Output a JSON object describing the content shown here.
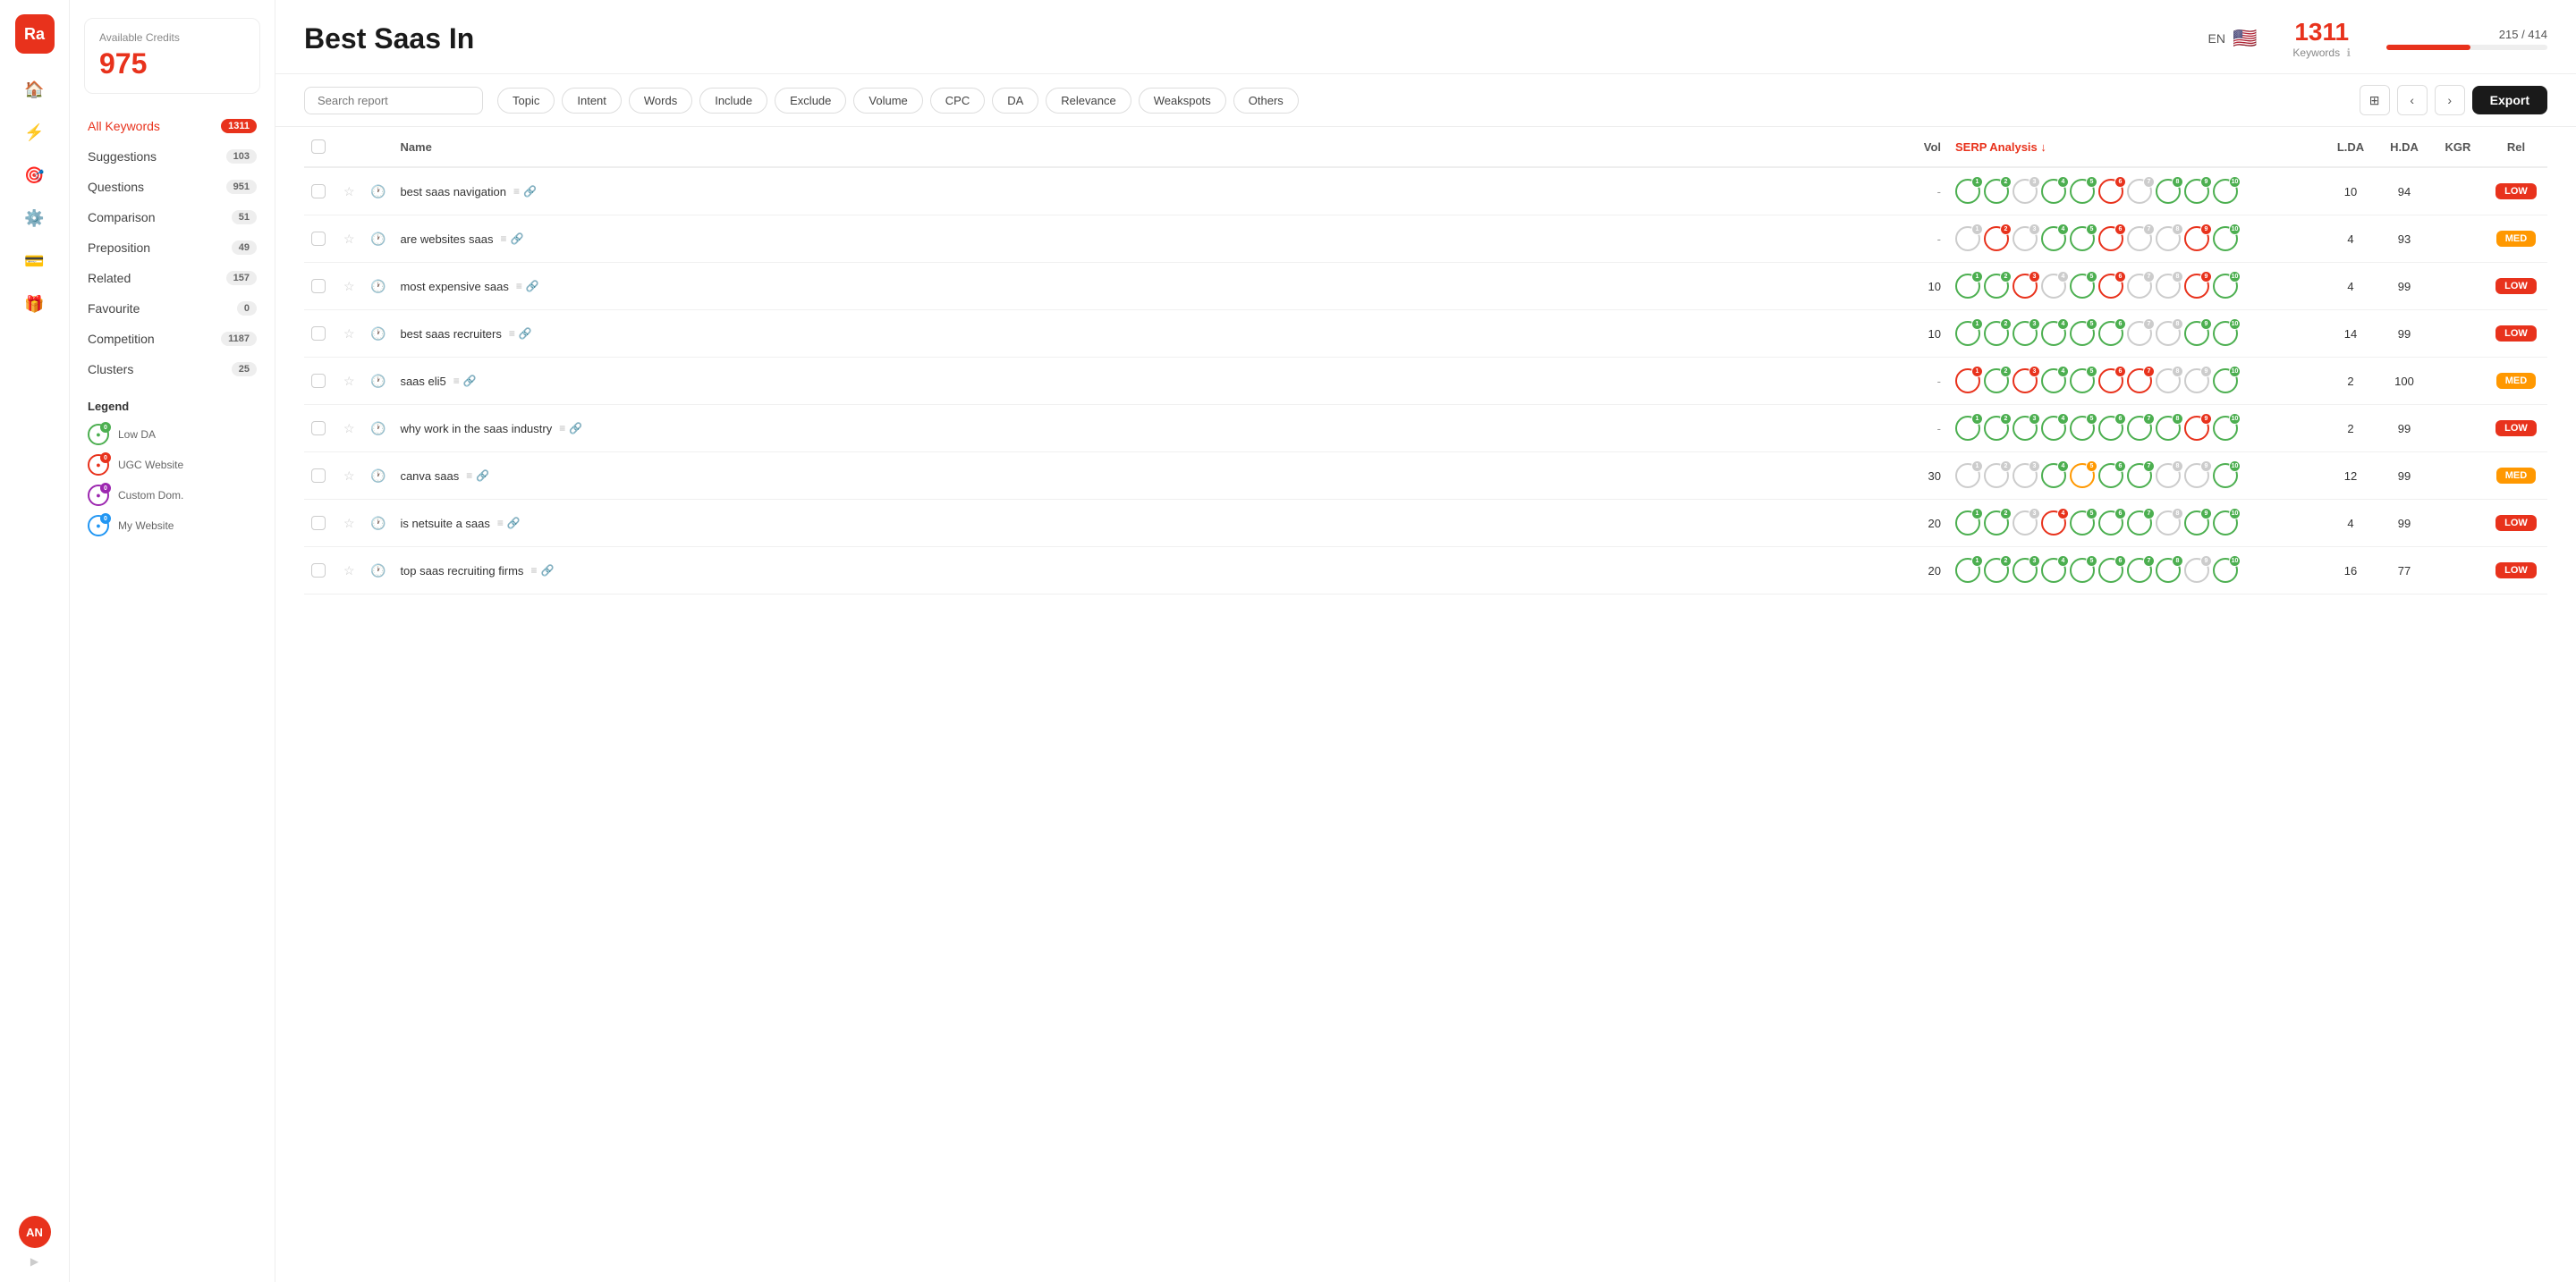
{
  "app": {
    "logo": "Ra",
    "nav_icons": [
      "home",
      "bolt",
      "target",
      "settings",
      "card",
      "gift"
    ],
    "user_initials": "AN"
  },
  "sidebar": {
    "credits_label": "Available Credits",
    "credits_value": "975",
    "items": [
      {
        "label": "All Keywords",
        "count": "1311",
        "active": true
      },
      {
        "label": "Suggestions",
        "count": "103",
        "active": false
      },
      {
        "label": "Questions",
        "count": "951",
        "active": false
      },
      {
        "label": "Comparison",
        "count": "51",
        "active": false
      },
      {
        "label": "Preposition",
        "count": "49",
        "active": false
      },
      {
        "label": "Related",
        "count": "157",
        "active": false
      },
      {
        "label": "Favourite",
        "count": "0",
        "active": false
      },
      {
        "label": "Competition",
        "count": "1187",
        "active": false
      },
      {
        "label": "Clusters",
        "count": "25",
        "active": false
      }
    ],
    "legend": {
      "title": "Legend",
      "items": [
        {
          "label": "Low DA",
          "type": "low"
        },
        {
          "label": "UGC Website",
          "type": "ugc"
        },
        {
          "label": "Custom Dom.",
          "type": "custom"
        },
        {
          "label": "My Website",
          "type": "my"
        }
      ]
    }
  },
  "header": {
    "title": "Best Saas In",
    "lang": "EN",
    "keywords_count": "1311",
    "keywords_label": "Keywords",
    "progress_text": "215 / 414",
    "progress_pct": 52
  },
  "toolbar": {
    "search_placeholder": "Search report",
    "filters": [
      "Topic",
      "Intent",
      "Words",
      "Include",
      "Exclude",
      "Volume",
      "CPC",
      "DA",
      "Relevance",
      "Weakspots",
      "Others"
    ],
    "export_label": "Export"
  },
  "table": {
    "columns": [
      "",
      "",
      "",
      "Name",
      "Vol",
      "SERP Analysis",
      "L.DA",
      "H.DA",
      "KGR",
      "Rel"
    ],
    "rows": [
      {
        "name": "best saas navigation",
        "vol": "-",
        "lda": 10,
        "hda": 94,
        "kgr": "",
        "rel": "LOW",
        "serp": [
          {
            "color": "green",
            "pos": 1
          },
          {
            "color": "green",
            "pos": 2
          },
          {
            "color": "grey",
            "pos": 3
          },
          {
            "color": "green",
            "pos": 4
          },
          {
            "color": "green",
            "pos": 5
          },
          {
            "color": "red",
            "pos": 6
          },
          {
            "color": "grey",
            "pos": 7
          },
          {
            "color": "green",
            "pos": 8
          },
          {
            "color": "green",
            "pos": 9
          },
          {
            "color": "green",
            "pos": 10
          }
        ]
      },
      {
        "name": "are websites saas",
        "vol": "-",
        "lda": 4,
        "hda": 93,
        "kgr": "",
        "rel": "MED",
        "serp": [
          {
            "color": "grey",
            "pos": 1
          },
          {
            "color": "red",
            "pos": 2
          },
          {
            "color": "grey",
            "pos": 3
          },
          {
            "color": "green",
            "pos": 4
          },
          {
            "color": "green",
            "pos": 5
          },
          {
            "color": "red",
            "pos": 6
          },
          {
            "color": "grey",
            "pos": 7
          },
          {
            "color": "grey",
            "pos": 8
          },
          {
            "color": "red",
            "pos": 9
          },
          {
            "color": "green",
            "pos": 10
          }
        ]
      },
      {
        "name": "most expensive saas",
        "vol": "10",
        "lda": 4,
        "hda": 99,
        "kgr": "",
        "rel": "LOW",
        "serp": [
          {
            "color": "green",
            "pos": 1
          },
          {
            "color": "green",
            "pos": 2
          },
          {
            "color": "red",
            "pos": 3
          },
          {
            "color": "grey",
            "pos": 4
          },
          {
            "color": "green",
            "pos": 5
          },
          {
            "color": "red",
            "pos": 6
          },
          {
            "color": "grey",
            "pos": 7
          },
          {
            "color": "grey",
            "pos": 8
          },
          {
            "color": "red",
            "pos": 9
          },
          {
            "color": "green",
            "pos": 10
          }
        ]
      },
      {
        "name": "best saas recruiters",
        "vol": "10",
        "lda": 14,
        "hda": 99,
        "kgr": "",
        "rel": "LOW",
        "serp": [
          {
            "color": "green",
            "pos": 1
          },
          {
            "color": "green",
            "pos": 2
          },
          {
            "color": "green",
            "pos": 3
          },
          {
            "color": "green",
            "pos": 4
          },
          {
            "color": "green",
            "pos": 5
          },
          {
            "color": "green",
            "pos": 6
          },
          {
            "color": "grey",
            "pos": 7
          },
          {
            "color": "grey",
            "pos": 8
          },
          {
            "color": "green",
            "pos": 9
          },
          {
            "color": "green",
            "pos": 10
          }
        ]
      },
      {
        "name": "saas eli5",
        "vol": "-",
        "lda": 2,
        "hda": 100,
        "kgr": "",
        "rel": "MED",
        "serp": [
          {
            "color": "red",
            "pos": 1
          },
          {
            "color": "green",
            "pos": 2
          },
          {
            "color": "red",
            "pos": 3
          },
          {
            "color": "green",
            "pos": 4
          },
          {
            "color": "green",
            "pos": 5
          },
          {
            "color": "red",
            "pos": 6
          },
          {
            "color": "red",
            "pos": 7
          },
          {
            "color": "grey",
            "pos": 8
          },
          {
            "color": "grey",
            "pos": 9
          },
          {
            "color": "green",
            "pos": 10
          }
        ]
      },
      {
        "name": "why work in the saas industry",
        "vol": "-",
        "lda": 2,
        "hda": 99,
        "kgr": "",
        "rel": "LOW",
        "serp": [
          {
            "color": "green",
            "pos": 1
          },
          {
            "color": "green",
            "pos": 2
          },
          {
            "color": "green",
            "pos": 3
          },
          {
            "color": "green",
            "pos": 4
          },
          {
            "color": "green",
            "pos": 5
          },
          {
            "color": "green",
            "pos": 6
          },
          {
            "color": "green",
            "pos": 7
          },
          {
            "color": "green",
            "pos": 8
          },
          {
            "color": "red",
            "pos": 9
          },
          {
            "color": "green",
            "pos": 10
          }
        ]
      },
      {
        "name": "canva saas",
        "vol": "30",
        "lda": 12,
        "hda": 99,
        "kgr": "",
        "rel": "MED",
        "serp": [
          {
            "color": "grey",
            "pos": 1
          },
          {
            "color": "grey",
            "pos": 2
          },
          {
            "color": "grey",
            "pos": 3
          },
          {
            "color": "green",
            "pos": 4
          },
          {
            "color": "orange",
            "pos": 5
          },
          {
            "color": "green",
            "pos": 6
          },
          {
            "color": "green",
            "pos": 7
          },
          {
            "color": "grey",
            "pos": 8
          },
          {
            "color": "grey",
            "pos": 9
          },
          {
            "color": "green",
            "pos": 10
          }
        ]
      },
      {
        "name": "is netsuite a saas",
        "vol": "20",
        "lda": 4,
        "hda": 99,
        "kgr": "",
        "rel": "LOW",
        "serp": [
          {
            "color": "green",
            "pos": 1
          },
          {
            "color": "green",
            "pos": 2
          },
          {
            "color": "grey",
            "pos": 3
          },
          {
            "color": "red",
            "pos": 4
          },
          {
            "color": "green",
            "pos": 5
          },
          {
            "color": "green",
            "pos": 6
          },
          {
            "color": "green",
            "pos": 7
          },
          {
            "color": "grey",
            "pos": 8
          },
          {
            "color": "green",
            "pos": 9
          },
          {
            "color": "green",
            "pos": 10
          }
        ]
      },
      {
        "name": "top saas recruiting firms",
        "vol": "20",
        "lda": 16,
        "hda": 77,
        "kgr": "",
        "rel": "LOW",
        "serp": [
          {
            "color": "green",
            "pos": 1
          },
          {
            "color": "green",
            "pos": 2
          },
          {
            "color": "green",
            "pos": 3
          },
          {
            "color": "green",
            "pos": 4
          },
          {
            "color": "green",
            "pos": 5
          },
          {
            "color": "green",
            "pos": 6
          },
          {
            "color": "green",
            "pos": 7
          },
          {
            "color": "green",
            "pos": 8
          },
          {
            "color": "grey",
            "pos": 9
          },
          {
            "color": "green",
            "pos": 10
          }
        ]
      }
    ]
  }
}
